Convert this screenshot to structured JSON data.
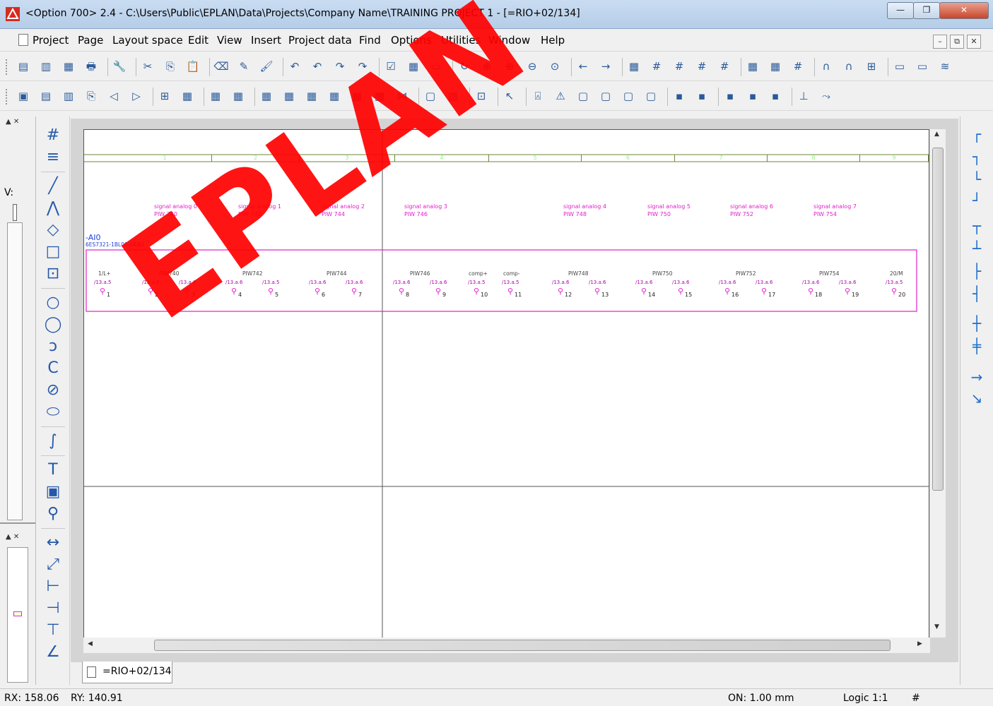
{
  "window": {
    "title": "<Option 700> 2.4 - C:\\Users\\Public\\EPLAN\\Data\\Projects\\Company Name\\TRAINING PROJECT 1 - [=RIO+02/134]",
    "min": "—",
    "max": "❐",
    "close": "✕"
  },
  "menu": [
    "Project",
    "Page",
    "Layout space",
    "Edit",
    "View",
    "Insert",
    "Project data",
    "Find",
    "Options",
    "Utilities",
    "Window",
    "Help"
  ],
  "mdi": {
    "min": "–",
    "restore": "⧉",
    "close": "✕"
  },
  "toolbar1_icons": [
    "new-page-icon",
    "open-page-icon",
    "page-props-icon",
    "print-icon",
    "wrench-icon",
    "cut-icon",
    "copy-icon",
    "paste-icon",
    "delete-icon",
    "format-icon",
    "format-brush-icon",
    "undo-icon",
    "undo-list-icon",
    "redo-icon",
    "redo-list-icon",
    "check-icon",
    "table-icon",
    "window-icon",
    "refresh-icon",
    "zoom-window-icon",
    "zoom-in-icon",
    "zoom-out-icon",
    "zoom-100-icon",
    "back-icon",
    "forward-icon",
    "grid-a-icon",
    "grid-b-icon",
    "grid-c-icon",
    "grid-d-icon",
    "grid-e-icon",
    "grid-icon",
    "grid-snap-icon",
    "snap-icon",
    "magnet-icon",
    "magnet-page-icon",
    "dims-icon",
    "display-icon",
    "monitor-icon",
    "plot-icon"
  ],
  "toolbar2_icons": [
    "select-icon",
    "new-icon",
    "open-icon",
    "copy-page-icon",
    "prev-page-icon",
    "next-page-icon",
    "insert-device-icon",
    "terminal-icon",
    "plc-icon",
    "plc-card-icon",
    "cable-icon",
    "cable-def-icon",
    "shield-icon",
    "box-icon",
    "potential-icon",
    "connect-icon",
    "interrupt-icon",
    "corner-icon",
    "hatch-icon",
    "rect-select-icon",
    "cursor-icon",
    "text-icon",
    "mirror-icon",
    "frame-icon",
    "box-insert-icon",
    "link-icon",
    "macro-icon",
    "highlight-icon",
    "orange-icon",
    "view-icon",
    "select-green-icon",
    "zoom-sel-icon",
    "line-icon",
    "arrow-icon"
  ],
  "drawtools": [
    "grid-icon",
    "grid-dense-icon",
    "line-icon",
    "polyline-icon",
    "polygon-icon",
    "rectangle-icon",
    "placeholder-icon",
    "circle-icon",
    "circle-3pt-icon",
    "arc-icon",
    "arc-3pt-icon",
    "ellipse-sector-icon",
    "ellipse-icon",
    "spline-icon",
    "text-icon",
    "picture-icon",
    "link-icon",
    "dimension-h-icon",
    "dimension-diag-icon",
    "dimension-chain-icon",
    "dimension-base-icon",
    "dimension-inc-icon",
    "dimension-angle-icon"
  ],
  "drawtools_glyphs": [
    "#",
    "≡",
    "╱",
    "⋀",
    "◇",
    "□",
    "⊡",
    "○",
    "◯",
    "ↄ",
    "C",
    "⊘",
    "⬭",
    "∫",
    "T",
    "▣",
    "⚲",
    "↔",
    "⤢",
    "⊢",
    "⊣",
    "⊤",
    "∠"
  ],
  "righttools": [
    "corner-tl-icon",
    "corner-tr-icon",
    "corner-bl-icon",
    "corner-br-icon",
    "tee-down-icon",
    "tee-up-icon",
    "tee-right-icon",
    "tee-left-icon",
    "cross-icon",
    "cross-alt-icon",
    "interrupt-icon",
    "angle-icon"
  ],
  "righttools_glyphs": [
    "┌",
    "┐",
    "└",
    "┘",
    "┬",
    "┴",
    "├",
    "┤",
    "┼",
    "╪",
    "→",
    "↘"
  ],
  "schematic": {
    "columns": [
      "1",
      "2",
      "3",
      "4",
      "5",
      "6",
      "7",
      "8",
      "9"
    ],
    "device_tag": "-AI0",
    "device_part": "6ES7321-1BL00-0AA0",
    "signals": [
      {
        "name": "signal analog 0",
        "addr": "PIW 740"
      },
      {
        "name": "signal analog 1",
        "addr": "PIW 742"
      },
      {
        "name": "signal analog 2",
        "addr": "PIW 744"
      },
      {
        "name": "signal analog 3",
        "addr": "PIW 746"
      },
      {
        "name": "signal analog 4",
        "addr": "PIW 748"
      },
      {
        "name": "signal analog 5",
        "addr": "PIW 750"
      },
      {
        "name": "signal analog 6",
        "addr": "PIW 752"
      },
      {
        "name": "signal analog 7",
        "addr": "PIW 754"
      }
    ],
    "tags": [
      "1/L+",
      "PIW740",
      "PIW742",
      "PIW744",
      "PIW746",
      "comp+",
      "comp-",
      "PIW748",
      "PIW750",
      "PIW752",
      "PIW754",
      "20/M"
    ],
    "connections": [
      "1",
      "2",
      "3",
      "4",
      "5",
      "6",
      "7",
      "8",
      "9",
      "10",
      "11",
      "12",
      "13",
      "14",
      "15",
      "16",
      "17",
      "18",
      "19",
      "20"
    ],
    "refs": [
      "/13.a.5",
      "/13.a.6",
      "/13.a.6",
      "/13.a.6",
      "/13.a.5",
      "/13.a.6",
      "/13.a.6",
      "/13.a.6",
      "/13.a.6",
      "/13.a.5",
      "/13.a.5",
      "/13.a.6",
      "/13.a.6",
      "/13.a.6",
      "/13.a.6",
      "/13.a.6",
      "/13.a.6",
      "/13.a.6",
      "/13.a.6",
      "/13.a.5"
    ]
  },
  "page_tab": "=RIO+02/134",
  "left_panel": {
    "label": "V:"
  },
  "status": {
    "rx": "RX: 158.06",
    "ry": "RY: 140.91",
    "on": "ON: 1.00 mm",
    "logic": "Logic 1:1",
    "hash": "#"
  },
  "watermark": "EPLAN",
  "colors": {
    "signal": "#e11ec9",
    "device": "#1f3fd8",
    "grid": "#6b8a3a",
    "watermark": "#ff0000"
  }
}
